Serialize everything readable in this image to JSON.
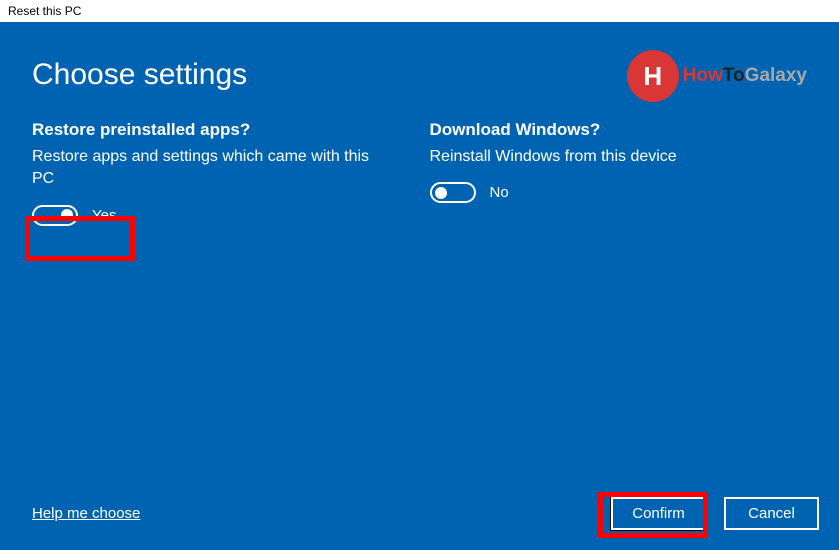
{
  "window": {
    "title": "Reset this PC"
  },
  "page": {
    "heading": "Choose settings"
  },
  "left": {
    "heading": "Restore preinstalled apps?",
    "desc": "Restore apps and settings which came with this PC",
    "toggle_state": "on",
    "toggle_label": "Yes"
  },
  "right": {
    "heading": "Download Windows?",
    "desc": "Reinstall Windows from this device",
    "toggle_state": "off",
    "toggle_label": "No"
  },
  "footer": {
    "help": "Help me choose",
    "confirm": "Confirm",
    "cancel": "Cancel"
  },
  "watermark": {
    "glyph": "H",
    "part1": "How",
    "part2": "To",
    "part3": "Galaxy"
  }
}
